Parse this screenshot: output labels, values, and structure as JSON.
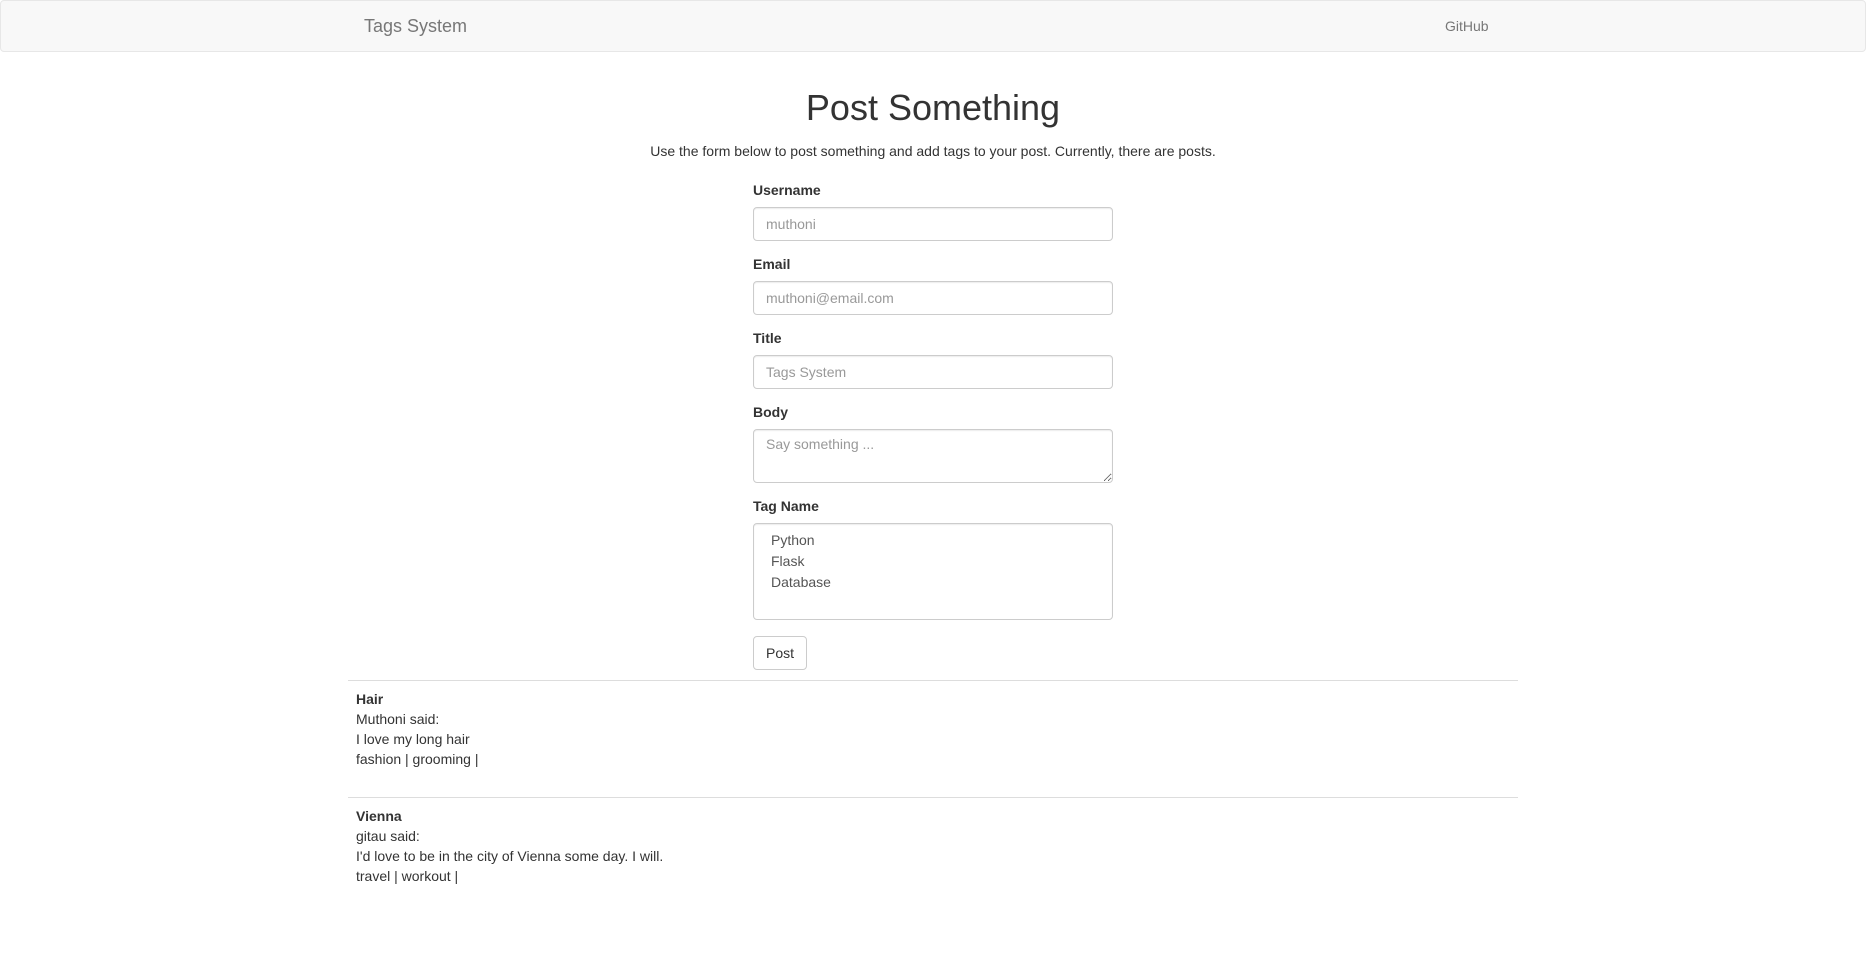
{
  "navbar": {
    "brand": "Tags System",
    "links": [
      {
        "label": "GitHub"
      }
    ]
  },
  "main": {
    "title": "Post Something",
    "lead": "Use the form below to post something and add tags to your post. Currently, there are posts."
  },
  "form": {
    "username": {
      "label": "Username",
      "placeholder": "muthoni"
    },
    "email": {
      "label": "Email",
      "placeholder": "muthoni@email.com"
    },
    "title": {
      "label": "Title",
      "placeholder": "Tags System"
    },
    "body": {
      "label": "Body",
      "placeholder": "Say something ..."
    },
    "tag": {
      "label": "Tag Name",
      "options": [
        "Python",
        "Flask",
        "Database"
      ]
    },
    "submit_label": "Post"
  },
  "posts": [
    {
      "title": "Hair",
      "author_line": "Muthoni said:",
      "body": "I love my long hair",
      "tags": "fashion | grooming |"
    },
    {
      "title": "Vienna",
      "author_line": "gitau said:",
      "body": "I'd love to be in the city of Vienna some day. I will.",
      "tags": "travel | workout |"
    }
  ]
}
